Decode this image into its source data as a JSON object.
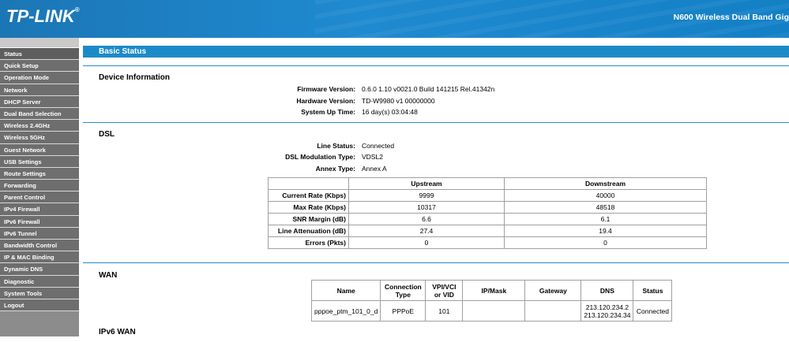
{
  "header": {
    "brand": "TP-LINK",
    "brand_mark": "®",
    "product": "N600 Wireless Dual Band Gig"
  },
  "sidebar": {
    "items": [
      "Status",
      "Quick Setup",
      "Operation Mode",
      "Network",
      "DHCP Server",
      "Dual Band Selection",
      "Wireless 2.4GHz",
      "Wireless 5GHz",
      "Guest Network",
      "USB Settings",
      "Route Settings",
      "Forwarding",
      "Parent Control",
      "IPv4 Firewall",
      "IPv6 Firewall",
      "IPv6 Tunnel",
      "Bandwidth Control",
      "IP & MAC Binding",
      "Dynamic DNS",
      "Diagnostic",
      "System Tools",
      "Logout"
    ]
  },
  "page": {
    "title": "Basic Status"
  },
  "device": {
    "title": "Device Information",
    "firmware_label": "Firmware Version:",
    "firmware_value": "0.6.0 1.10 v0021.0 Build 141215 Rel.41342n",
    "hardware_label": "Hardware Version:",
    "hardware_value": "TD-W9980 v1 00000000",
    "uptime_label": "System Up Time:",
    "uptime_value": "16 day(s) 03:04:48"
  },
  "dsl": {
    "title": "DSL",
    "line_status_label": "Line Status:",
    "line_status_value": "Connected",
    "modulation_label": "DSL Modulation Type:",
    "modulation_value": "VDSL2",
    "annex_label": "Annex Type:",
    "annex_value": "Annex A",
    "table": {
      "headers": [
        "",
        "Upstream",
        "Downstream"
      ],
      "rows": [
        [
          "Current Rate (Kbps)",
          "9999",
          "40000"
        ],
        [
          "Max Rate (Kbps)",
          "10317",
          "48518"
        ],
        [
          "SNR Margin (dB)",
          "6.6",
          "6.1"
        ],
        [
          "Line Attenuation (dB)",
          "27.4",
          "19.4"
        ],
        [
          "Errors (Pkts)",
          "0",
          "0"
        ]
      ]
    }
  },
  "wan": {
    "title": "WAN",
    "headers": [
      "Name",
      "Connection Type",
      "VPI/VCI or VID",
      "IP/Mask",
      "Gateway",
      "DNS",
      "Status"
    ],
    "row": {
      "name": "pppoe_ptm_101_0_d",
      "type": "PPPoE",
      "vid": "101",
      "ip": "",
      "gateway": "",
      "dns1": "213.120.234.2",
      "dns2": "213.120.234.34",
      "status": "Connected"
    }
  },
  "ipv6wan": {
    "title": "IPv6 WAN"
  }
}
